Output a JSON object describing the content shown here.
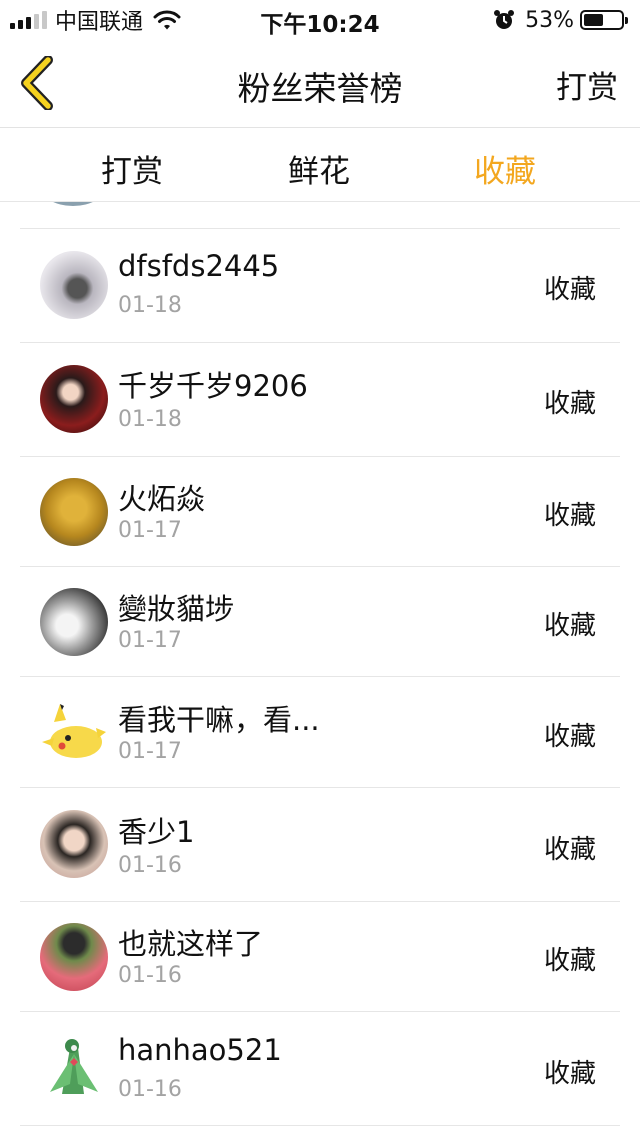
{
  "status_bar": {
    "carrier": "中国联通",
    "time": "下午10:24",
    "battery_pct": "53%",
    "battery_level": 0.53
  },
  "nav": {
    "title": "粉丝荣誉榜",
    "right_action": "打赏",
    "back_icon": "chevron-left-icon"
  },
  "tabs": [
    {
      "label": "打赏",
      "active": false
    },
    {
      "label": "鲜花",
      "active": false
    },
    {
      "label": "收藏",
      "active": true
    }
  ],
  "colors": {
    "accent": "#f3a71f",
    "back_icon": "#f5d21f"
  },
  "list": [
    {
      "name": "dfsfds2445",
      "date": "01-18",
      "tag": "收藏"
    },
    {
      "name": "千岁千岁9206",
      "date": "01-18",
      "tag": "收藏"
    },
    {
      "name": "火炻焱",
      "date": "01-17",
      "tag": "收藏"
    },
    {
      "name": "變妝貓埗",
      "date": "01-17",
      "tag": "收藏"
    },
    {
      "name": "看我干嘛，看...",
      "date": "01-17",
      "tag": "收藏"
    },
    {
      "name": "香少1",
      "date": "01-16",
      "tag": "收藏"
    },
    {
      "name": "也就这样了",
      "date": "01-16",
      "tag": "收藏"
    },
    {
      "name": "hanhao521",
      "date": "01-16",
      "tag": "收藏"
    }
  ]
}
